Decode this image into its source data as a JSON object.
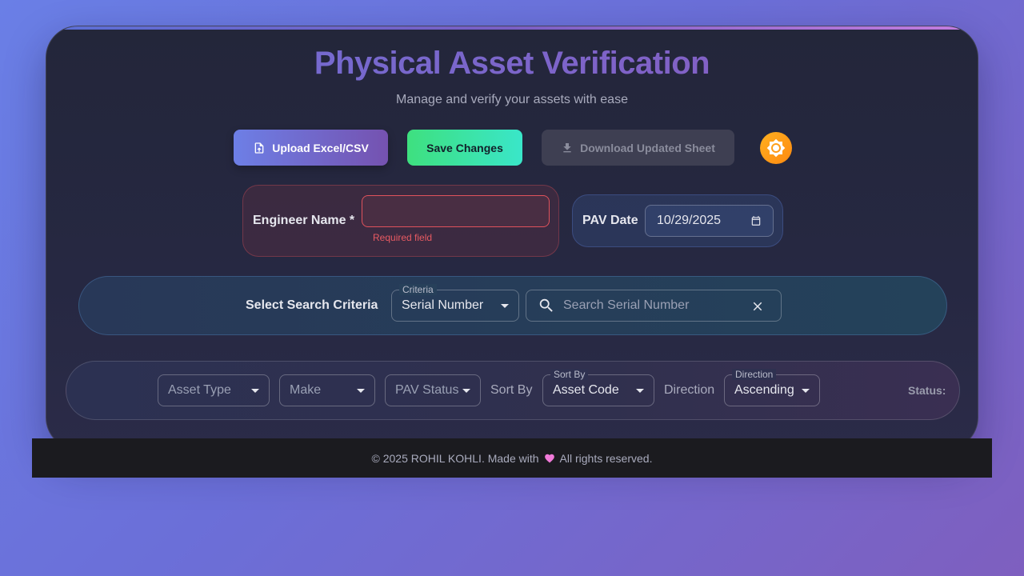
{
  "header": {
    "title": "Physical Asset Verification",
    "subtitle": "Manage and verify your assets with ease"
  },
  "toolbar": {
    "upload_label": "Upload Excel/CSV",
    "save_label": "Save Changes",
    "download_label": "Download Updated Sheet",
    "theme_icon": "brightness-icon"
  },
  "engineer": {
    "label": "Engineer Name *",
    "value": "",
    "error": "Required field"
  },
  "pav_date": {
    "label": "PAV Date",
    "value": "10/29/2025"
  },
  "search": {
    "label": "Select Search Criteria",
    "criteria_label": "Criteria",
    "criteria_value": "Serial Number",
    "placeholder": "Search Serial Number"
  },
  "filters": {
    "asset_type": "Asset Type",
    "make": "Make",
    "pav_status": "PAV Status",
    "sort_by_text": "Sort By",
    "sort_by_label": "Sort By",
    "sort_by_value": "Asset Code",
    "direction_text": "Direction",
    "direction_label": "Direction",
    "direction_value": "Ascending",
    "status_label": "Status:"
  },
  "footer": {
    "text_before": "© 2025 ROHIL KOHLI. Made with",
    "text_after": "All rights reserved."
  },
  "colors": {
    "accent": "#6d6fd4",
    "save": "#3ee07f",
    "error": "#e85a62",
    "theme_toggle": "#ff9a10"
  }
}
